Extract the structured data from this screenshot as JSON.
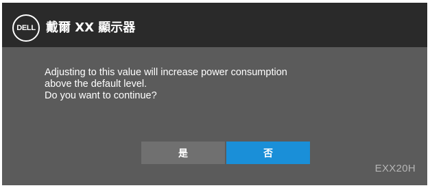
{
  "header": {
    "logo_text": "DELL",
    "title": "戴爾 XX 顯示器"
  },
  "dialog": {
    "message_lines": [
      "Adjusting to this value will increase power consumption",
      "above the default level.",
      "Do you want to continue?"
    ],
    "yes_label": "是",
    "no_label": "否",
    "selected": "no"
  },
  "footer": {
    "model": "EXX20H"
  },
  "colors": {
    "panel_bg": "#5b5b5b",
    "header_bg": "#2a2a2a",
    "button_default": "#707070",
    "button_selected": "#1a8fd8",
    "model_text": "#b5b5b5"
  }
}
